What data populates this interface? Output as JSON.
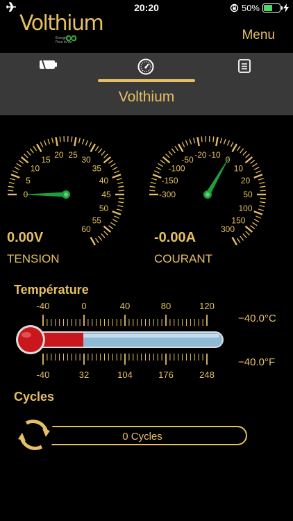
{
  "status_bar": {
    "time": "20:20",
    "battery_percent": "50%",
    "battery_level": 0.5,
    "airplane_mode": true
  },
  "header": {
    "logo_text": "Volthium",
    "logo_tagline_1": "Energie",
    "logo_tagline_2": "Pour la vie",
    "menu_label": "Menu"
  },
  "tabs": {
    "items": [
      {
        "icon": "battery-icon"
      },
      {
        "icon": "gauge-icon",
        "active": true
      },
      {
        "icon": "document-icon"
      }
    ],
    "title": "Volthium"
  },
  "gauges": {
    "voltage": {
      "value_text": "0.00V",
      "label": "TENSION",
      "min": 0,
      "max": 60,
      "value": 0,
      "tick_labels": [
        "0",
        "5",
        "10",
        "15",
        "20",
        "25",
        "30",
        "35",
        "40",
        "45",
        "50",
        "55",
        "60"
      ]
    },
    "current": {
      "value_text": "-0.00A",
      "label": "COURANT",
      "min": -300,
      "max": 300,
      "value": 0,
      "tick_labels": [
        "-300",
        "-150",
        "-100",
        "-50",
        "-20",
        "-10",
        "0",
        "10",
        "20",
        "50",
        "100",
        "150",
        "300"
      ]
    }
  },
  "temperature": {
    "title": "Température",
    "celsius_scale": [
      "-40",
      "0",
      "40",
      "80",
      "120"
    ],
    "fahrenheit_scale": [
      "-40",
      "32",
      "104",
      "176",
      "248"
    ],
    "celsius_value": "−40.0°C",
    "fahrenheit_value": "−40.0°F",
    "level_celsius": -40
  },
  "cycles": {
    "title": "Cycles",
    "value_text": "0 Cycles"
  },
  "colors": {
    "accent": "#e6c063",
    "needle": "#1f9e3c",
    "thermo_red": "#c8181d",
    "thermo_blue": "#8fbad6"
  }
}
